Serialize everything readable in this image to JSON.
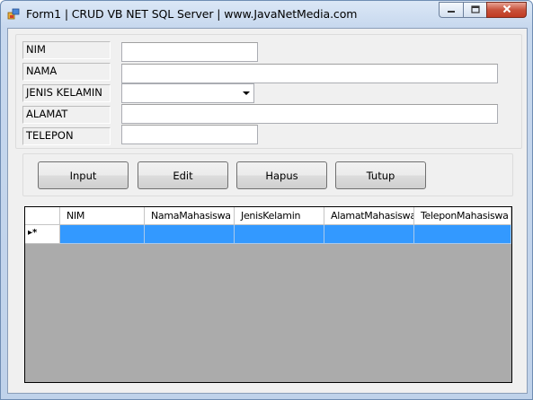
{
  "window": {
    "title": "Form1 | CRUD VB NET SQL Server | www.JavaNetMedia.com",
    "controls": {
      "minimize_icon": "minimize-icon",
      "maximize_icon": "maximize-icon",
      "close_icon": "close-icon"
    }
  },
  "form": {
    "fields": [
      {
        "label": "NIM",
        "value": ""
      },
      {
        "label": "NAMA",
        "value": ""
      },
      {
        "label": "JENIS KELAMIN",
        "value": ""
      },
      {
        "label": "ALAMAT",
        "value": ""
      },
      {
        "label": "TELEPON",
        "value": ""
      }
    ]
  },
  "buttons": {
    "input": "Input",
    "edit": "Edit",
    "hapus": "Hapus",
    "tutup": "Tutup"
  },
  "grid": {
    "columns": [
      "NIM",
      "NamaMahasiswa",
      "JenisKelamin",
      "AlamatMahasiswa",
      "TeleponMahasiswa"
    ],
    "new_row_marker": "▸*",
    "rows": []
  },
  "colors": {
    "selection": "#3399ff",
    "grid_background": "#ababab",
    "client_background": "#f0f0f0"
  }
}
